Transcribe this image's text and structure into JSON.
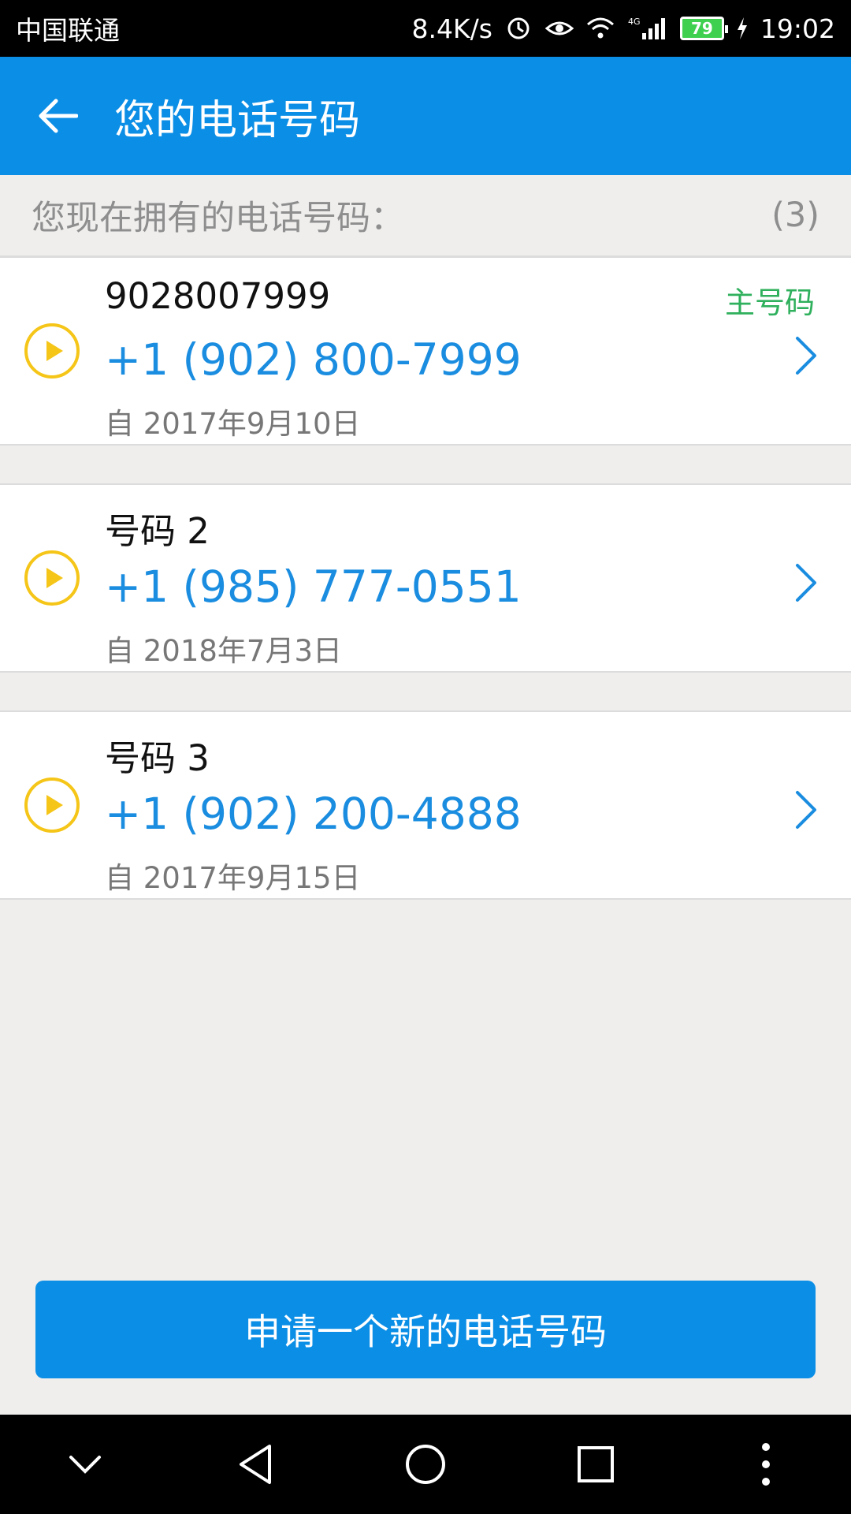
{
  "status": {
    "carrier": "中国联通",
    "speed": "8.4K/s",
    "network": "4G",
    "battery": "79",
    "time": "19:02"
  },
  "header": {
    "title": "您的电话号码"
  },
  "summary": {
    "label": "您现在拥有的电话号码：",
    "count": "(3)"
  },
  "numbers": [
    {
      "name": "9028007999",
      "number": "+1 (902) 800-7999",
      "since": "自 2017年9月10日",
      "tag": "主号码"
    },
    {
      "name": "号码 2",
      "number": "+1 (985) 777-0551",
      "since": "自 2018年7月3日"
    },
    {
      "name": "号码 3",
      "number": "+1 (902) 200-4888",
      "since": "自 2017年9月15日"
    }
  ],
  "cta": {
    "label": "申请一个新的电话号码"
  },
  "colors": {
    "accent": "#0b8ee6",
    "number_text": "#1a8de0",
    "primary_tag": "#2fb05c",
    "play_icon": "#f5c518"
  }
}
